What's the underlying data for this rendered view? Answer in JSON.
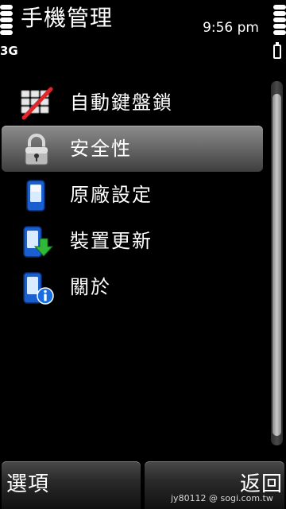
{
  "status": {
    "title": "手機管理",
    "time": "9:56 pm",
    "network": "3G"
  },
  "menu": {
    "items": [
      {
        "label": "自動鍵盤鎖",
        "icon": "keypad-lock-icon",
        "selected": false
      },
      {
        "label": "安全性",
        "icon": "padlock-icon",
        "selected": true
      },
      {
        "label": "原廠設定",
        "icon": "phone-icon",
        "selected": false
      },
      {
        "label": "裝置更新",
        "icon": "phone-download-icon",
        "selected": false
      },
      {
        "label": "關於",
        "icon": "phone-info-icon",
        "selected": false
      }
    ]
  },
  "softkeys": {
    "left_label": "選項",
    "right_label": "返回"
  },
  "watermark": "jy80112 @ sogi.com.tw",
  "colors": {
    "background": "#000000",
    "highlight": "#6a6a6a",
    "text": "#ffffff",
    "icon_blue": "#1a5fd0"
  }
}
